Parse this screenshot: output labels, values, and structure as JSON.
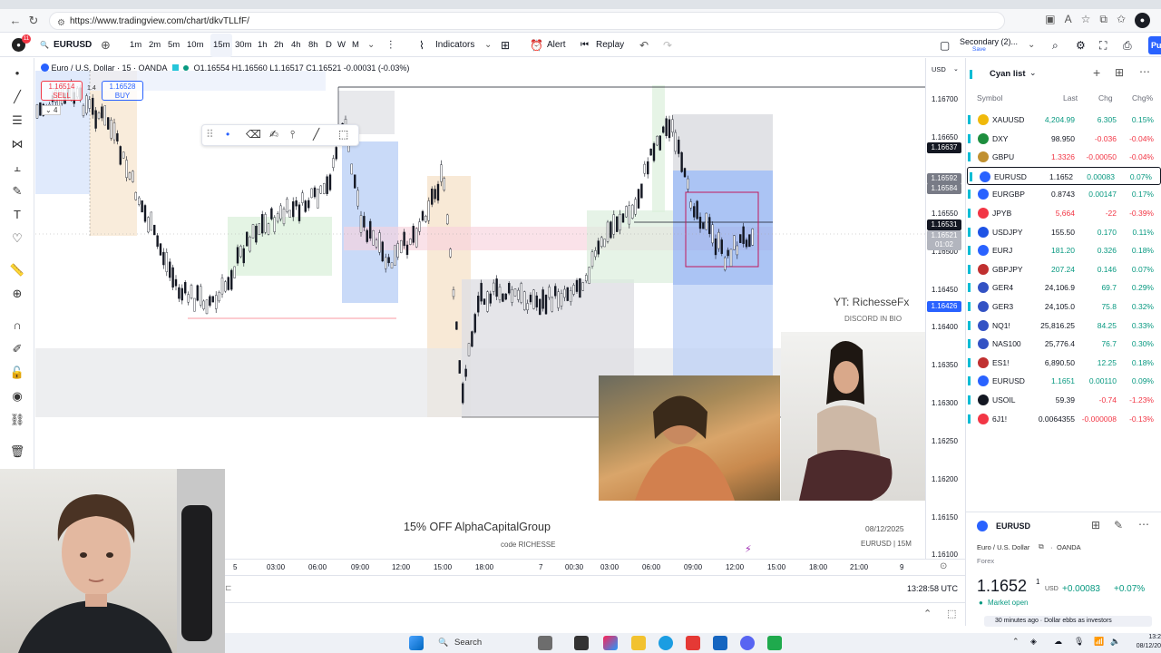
{
  "browser": {
    "url": "https://www.tradingview.com/chart/dkvTLLfF/"
  },
  "toolbar": {
    "symbol": "EURUSD",
    "notif_count": "11",
    "intervals": [
      "1m",
      "2m",
      "5m",
      "10m",
      "15m",
      "30m",
      "1h",
      "2h",
      "4h",
      "8h",
      "D",
      "W",
      "M"
    ],
    "active_interval": "15m",
    "indicators": "Indicators",
    "alert": "Alert",
    "replay": "Replay",
    "layout": "Secondary (2)...",
    "layout_sub": "Save",
    "publish": "Pu"
  },
  "legend": {
    "title": "Euro / U.S. Dollar · 15 · OANDA",
    "o": "O1.16554",
    "h": "H1.16560",
    "l": "L1.16517",
    "c": "C1.16521",
    "chg": "-0.00031 (-0.03%)"
  },
  "sell": {
    "price": "1.16514",
    "label": "SELL"
  },
  "buy": {
    "price": "1.16528",
    "label": "BUY"
  },
  "spread": "1.4",
  "counter": "4",
  "yaxis": {
    "currency": "USD",
    "ticks": [
      "1.16700",
      "1.16650",
      "1.16550",
      "1.16500",
      "1.16450",
      "1.16400",
      "1.16350",
      "1.16300",
      "1.16250",
      "1.16200",
      "1.16150",
      "1.16100"
    ],
    "labels": [
      {
        "v": "1.16637",
        "c": "#131722"
      },
      {
        "v": "1.16592",
        "c": "#787b86"
      },
      {
        "v": "1.16584",
        "c": "#787b86"
      },
      {
        "v": "1.16531",
        "c": "#131722"
      },
      {
        "v": "1.16521",
        "c": "#b2b5be"
      },
      {
        "v": "01:02",
        "c": "#b2b5be"
      },
      {
        "v": "1.16426",
        "c": "#2962ff"
      }
    ]
  },
  "xaxis": {
    "ticks": [
      "5",
      "03:00",
      "06:00",
      "09:00",
      "12:00",
      "15:00",
      "18:00",
      "7",
      "00:30",
      "03:00",
      "06:00",
      "09:00",
      "12:00",
      "15:00",
      "18:00",
      "21:00",
      "9"
    ]
  },
  "utc": "13:28:58 UTC",
  "promo": {
    "line1": "15% OFF AlphaCapitalGroup",
    "line2": "code RICHESSE"
  },
  "watermark": {
    "yt": "YT: RichesseFx",
    "discord": "DISCORD IN BIO",
    "date": "08/12/2025",
    "symtf": "EURUSD | 15M"
  },
  "watchlist": {
    "name": "Cyan list",
    "cols": {
      "symbol": "Symbol",
      "last": "Last",
      "chg": "Chg",
      "chgp": "Chg%"
    },
    "rows": [
      {
        "sym": "XAUUSD",
        "last": "4,204.99",
        "chg": "6.305",
        "chgp": "0.15%",
        "up": true,
        "icon": "#f0b90b"
      },
      {
        "sym": "DXY",
        "last": "98.950",
        "chg": "-0.036",
        "chgp": "-0.04%",
        "up": false,
        "icon": "#1e8e3e"
      },
      {
        "sym": "GBPU",
        "last": "1.3326",
        "chg": "-0.00050",
        "chgp": "-0.04%",
        "up": false,
        "icon": "#c09030"
      },
      {
        "sym": "EURUSD",
        "last": "1.1652",
        "chg": "0.00083",
        "chgp": "0.07%",
        "up": true,
        "icon": "#2962ff",
        "sel": true
      },
      {
        "sym": "EURGBP",
        "last": "0.8743",
        "chg": "0.00147",
        "chgp": "0.17%",
        "up": true,
        "icon": "#2962ff"
      },
      {
        "sym": "JPYB",
        "last": "5,664",
        "chg": "-22",
        "chgp": "-0.39%",
        "up": false,
        "icon": "#f23645"
      },
      {
        "sym": "USDJPY",
        "last": "155.50",
        "chg": "0.170",
        "chgp": "0.11%",
        "up": true,
        "icon": "#1e53e5"
      },
      {
        "sym": "EURJ",
        "last": "181.20",
        "chg": "0.326",
        "chgp": "0.18%",
        "up": true,
        "icon": "#2962ff"
      },
      {
        "sym": "GBPJPY",
        "last": "207.24",
        "chg": "0.146",
        "chgp": "0.07%",
        "up": true,
        "icon": "#c03030"
      },
      {
        "sym": "GER4",
        "last": "24,106.9",
        "chg": "69.7",
        "chgp": "0.29%",
        "up": true,
        "icon": "#3352c4"
      },
      {
        "sym": "GER3",
        "last": "24,105.0",
        "chg": "75.8",
        "chgp": "0.32%",
        "up": true,
        "icon": "#3352c4"
      },
      {
        "sym": "NQ1!",
        "last": "25,816.25",
        "chg": "84.25",
        "chgp": "0.33%",
        "up": true,
        "icon": "#3352c4"
      },
      {
        "sym": "NAS100",
        "last": "25,776.4",
        "chg": "76.7",
        "chgp": "0.30%",
        "up": true,
        "icon": "#3352c4"
      },
      {
        "sym": "ES1!",
        "last": "6,890.50",
        "chg": "12.25",
        "chgp": "0.18%",
        "up": true,
        "icon": "#c03030"
      },
      {
        "sym": "EURUSD",
        "last": "1.1651",
        "chg": "0.00110",
        "chgp": "0.09%",
        "up": true,
        "icon": "#2962ff"
      },
      {
        "sym": "USOIL",
        "last": "59.39",
        "chg": "-0.74",
        "chgp": "-1.23%",
        "up": false,
        "icon": "#131722"
      },
      {
        "sym": "6J1!",
        "last": "0.0064355",
        "chg": "-0.000008",
        "chgp": "-0.13%",
        "up": false,
        "icon": "#f23645"
      }
    ]
  },
  "detail": {
    "symbol": "EURUSD",
    "name": "Euro / U.S. Dollar",
    "exchange": "OANDA",
    "type": "Forex",
    "price": "1.1652",
    "price_sup": "1",
    "cur": "USD",
    "chg": "+0.00083",
    "chgp": "+0.07%",
    "status": "Market open",
    "news": "30 minutes ago · Dollar ebbs as investors"
  },
  "taskbar": {
    "search": "Search",
    "time": "13:2",
    "date": "08/12/20"
  }
}
